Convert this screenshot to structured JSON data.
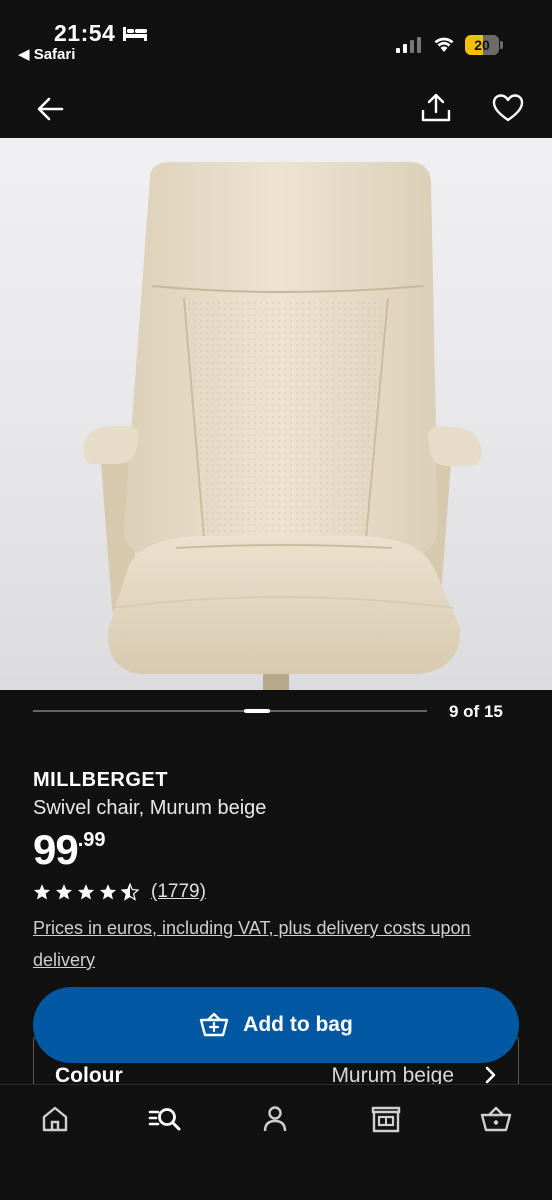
{
  "status_bar": {
    "time": "21:54",
    "back_app": "◀ Safari",
    "battery": "20"
  },
  "header": {
    "icons": [
      "back-arrow-icon",
      "share-icon",
      "heart-icon"
    ]
  },
  "carousel": {
    "counter": "9 of 15",
    "current": 9,
    "total": 15
  },
  "product": {
    "name": "MILLBERGET",
    "description": "Swivel chair, Murum beige",
    "price_integer": "99",
    "price_decimal": ".99",
    "rating": 4.5,
    "reviews": "(1779)",
    "vat_note": "Prices in euros, including VAT, plus delivery costs upon delivery"
  },
  "actions": {
    "add_to_bag": "Add to bag"
  },
  "colour": {
    "label": "Colour",
    "value": "Murum beige"
  },
  "tab_bar": {
    "items": [
      "home-icon",
      "search-icon",
      "profile-icon",
      "store-icon",
      "basket-icon"
    ]
  },
  "colors": {
    "background": "#111111",
    "primary_button": "#0058a3",
    "battery": "#f2c200",
    "chair": "#e8dcc6"
  }
}
